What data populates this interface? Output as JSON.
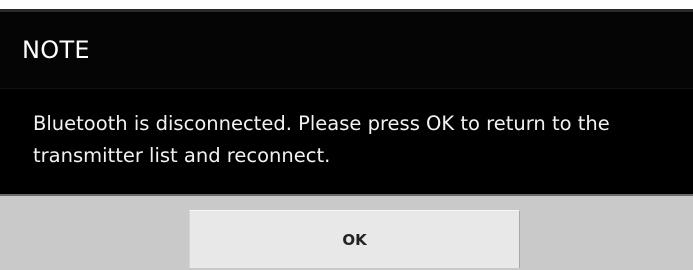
{
  "dialog": {
    "title": "NOTE",
    "message": "Bluetooth is disconnected. Please press OK to return to the transmitter list and reconnect.",
    "ok_label": "OK"
  },
  "colors": {
    "dialog_background": "#000000",
    "button_bar": "#c9c9c9",
    "button": "#e8e8e8",
    "text": "#ffffff"
  }
}
